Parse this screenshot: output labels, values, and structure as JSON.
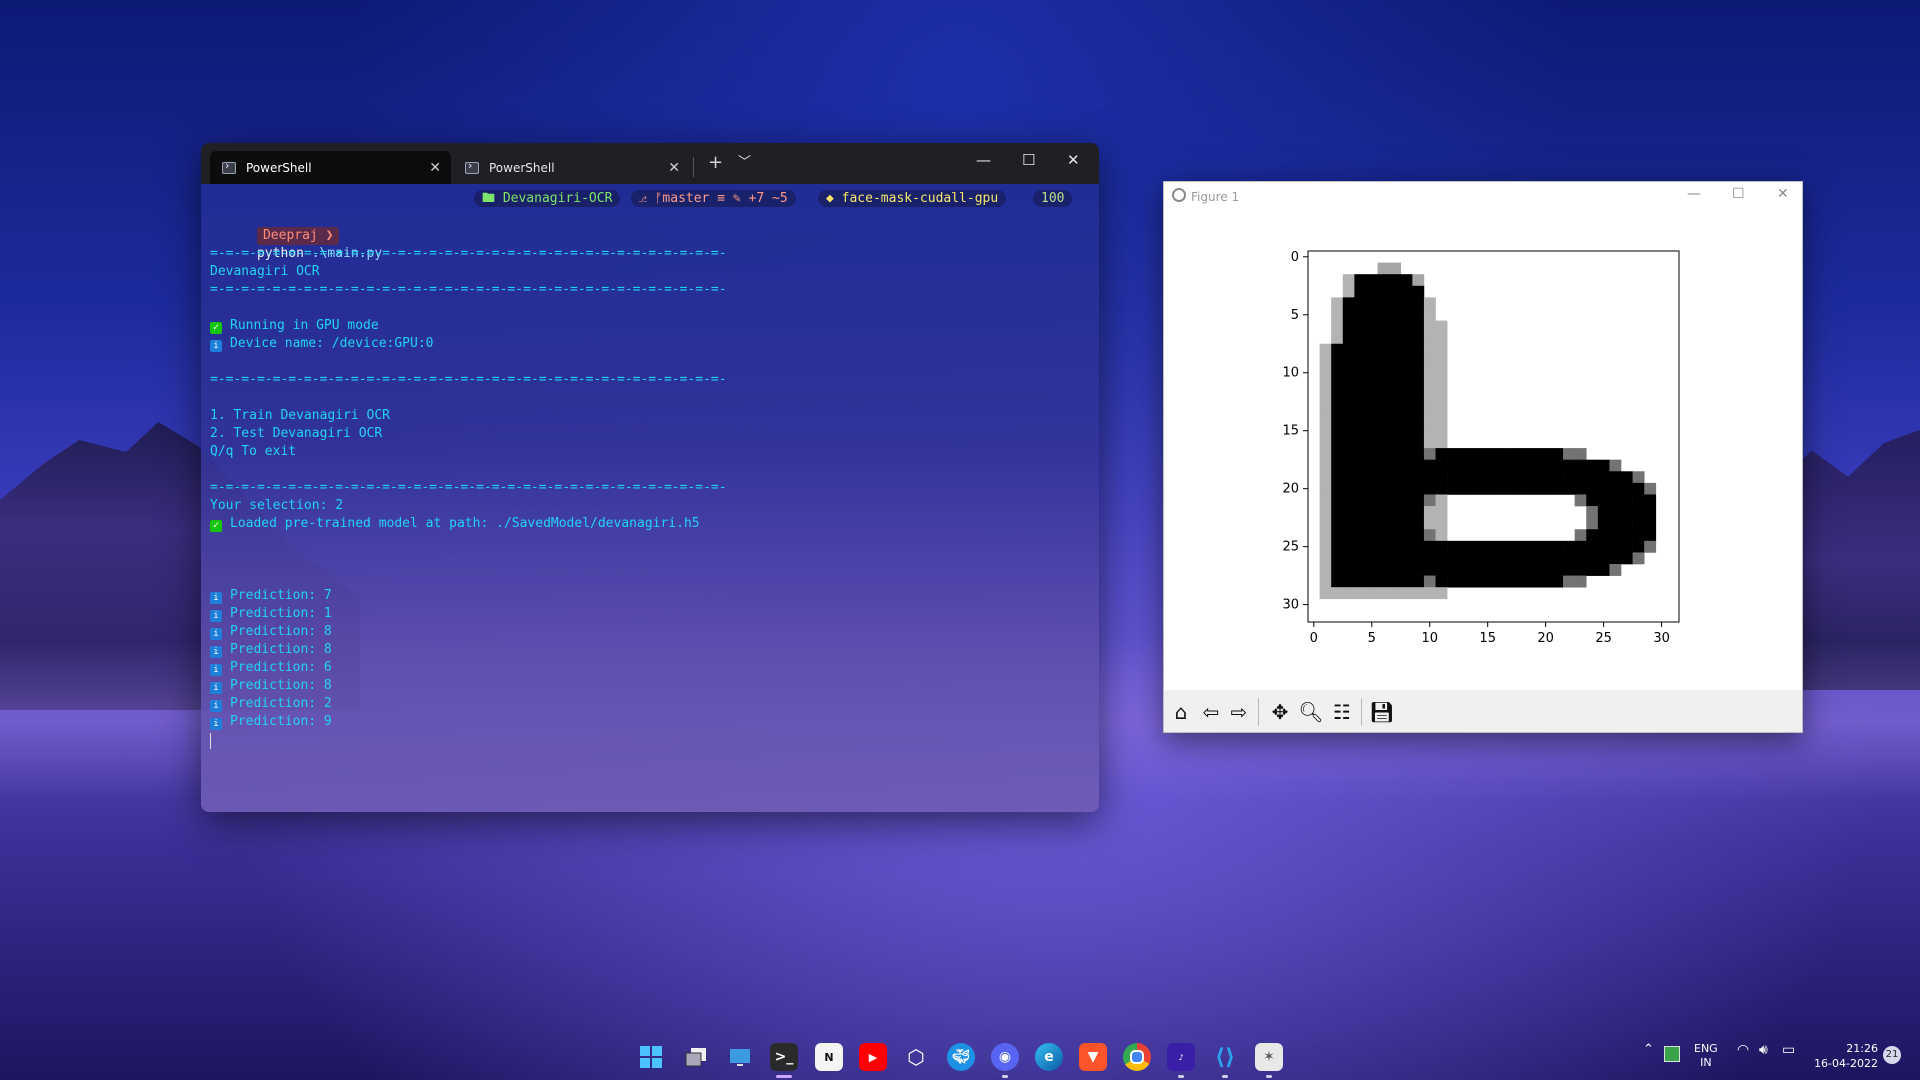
{
  "terminal": {
    "tabs": [
      {
        "label": "PowerShell",
        "active": true
      },
      {
        "label": "PowerShell",
        "active": false
      }
    ],
    "new_tab_icon": "+",
    "dropdown_icon": "chevron-down",
    "prompt": {
      "user": "Deepraj ❯",
      "command": "python",
      "arg": ".\\main.py"
    },
    "status": {
      "dir": "🖿 Devanagiri-OCR",
      "git": "⎇ ᚠmaster ≡ ✎ +7 ~5",
      "env": "◆ face-mask-cudall-gpu",
      "num": "100"
    },
    "output": {
      "separator": "=-=-=-=-=-=-=-=-=-=-=-=-=-=-=-=-=-=-=-=-=-=-=-=-=-=-=-=-=-=-=-=-=-",
      "title": "Devanagiri OCR",
      "gpu_mode": "Running in GPU mode",
      "device": "Device name: /device:GPU:0",
      "menu": [
        "1. Train Devanagiri OCR",
        "2. Test Devanagiri OCR",
        "Q/q To exit"
      ],
      "selection": "Your selection: 2",
      "loaded": "Loaded pre-trained model at path: ./SavedModel/devanagiri.h5",
      "predictions": [
        "Prediction: 7",
        "Prediction: 1",
        "Prediction: 8",
        "Prediction: 8",
        "Prediction: 6",
        "Prediction: 8",
        "Prediction: 2",
        "Prediction: 9"
      ]
    }
  },
  "figure": {
    "title": "Figure 1",
    "xticks": [
      "0",
      "5",
      "10",
      "15",
      "20",
      "25",
      "30"
    ],
    "yticks": [
      "0",
      "5",
      "10",
      "15",
      "20",
      "25",
      "30"
    ],
    "toolbar_icons": [
      "home-icon",
      "back-icon",
      "forward-icon",
      "pan-icon",
      "zoom-icon",
      "configure-icon",
      "save-icon"
    ]
  },
  "chart_data": {
    "type": "heatmap",
    "title": "",
    "xlabel": "",
    "ylabel": "",
    "xlim": [
      0,
      31
    ],
    "ylim": [
      31,
      0
    ],
    "colormap": "gray_r",
    "grid": false,
    "description_shape": "handwritten character rendered as 32x32 grayscale image",
    "rows": 32,
    "cols": 32
  },
  "taskbar": {
    "apps": [
      "windows-icon",
      "task-view-icon",
      "desktop-icon",
      "terminal-icon",
      "notion-icon",
      "youtube-icon",
      "cube-icon",
      "docker-icon",
      "discord-icon",
      "edge-icon",
      "brave-icon",
      "chrome-icon",
      "amazon-music-icon",
      "vscode-icon",
      "figure-icon"
    ],
    "lang_top": "ENG",
    "lang_bottom": "IN",
    "time": "21:26",
    "date": "16-04-2022",
    "badge": "21"
  }
}
